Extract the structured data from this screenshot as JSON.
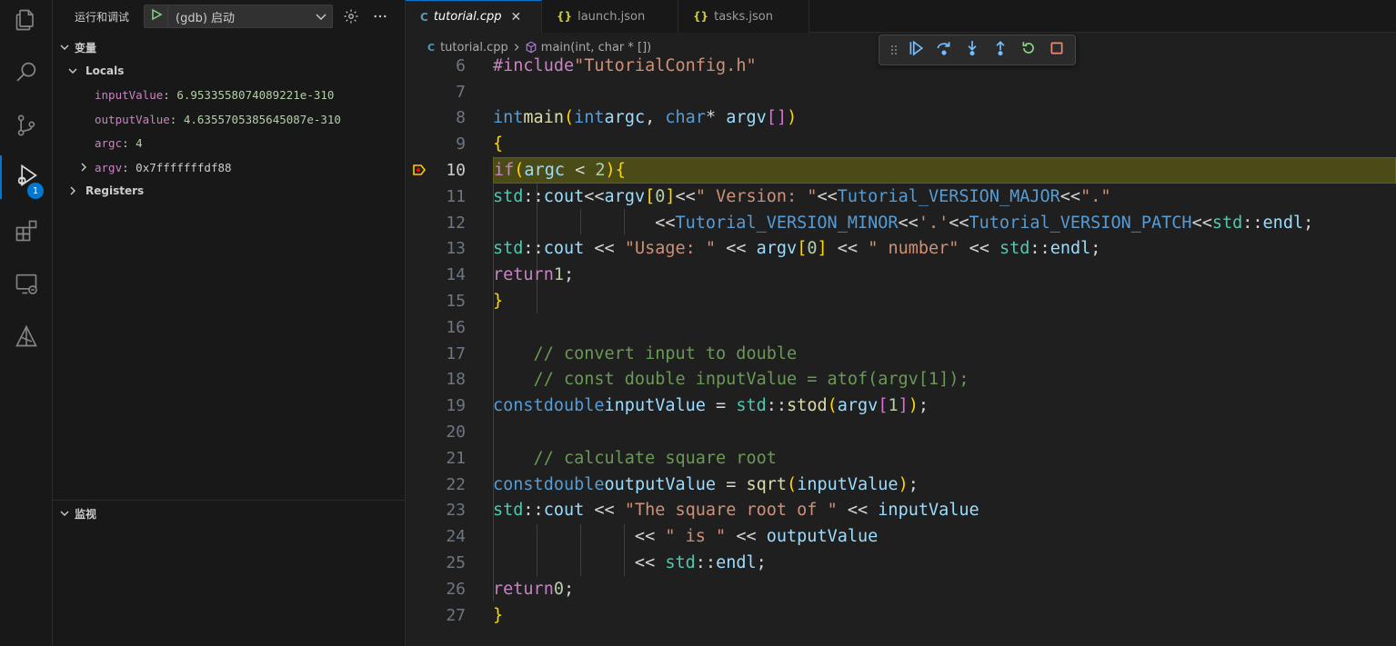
{
  "sidebar": {
    "title": "运行和调试",
    "config_label": "(gdb) 启动",
    "variables_label": "变量",
    "locals_label": "Locals",
    "variables": [
      {
        "name": "inputValue",
        "value": "6.9533558074089221e-310"
      },
      {
        "name": "outputValue",
        "value": "4.6355705385645087e-310"
      },
      {
        "name": "argc",
        "value": "4"
      },
      {
        "name": "argv",
        "value": "0x7fffffffdf88"
      }
    ],
    "registers_label": "Registers",
    "watch_label": "监视"
  },
  "activity": {
    "badge": "1",
    "icons": [
      "explorer-icon",
      "search-icon",
      "source-control-icon",
      "run-debug-icon",
      "extensions-icon",
      "remote-explorer-icon",
      "cmake-icon"
    ]
  },
  "tabs": [
    {
      "label": "tutorial.cpp",
      "icon": "C",
      "active": true
    },
    {
      "label": "launch.json",
      "icon": "{}",
      "active": false
    },
    {
      "label": "tasks.json",
      "icon": "{}",
      "active": false
    }
  ],
  "breadcrumb": {
    "file": "tutorial.cpp",
    "symbol": "main(int, char * [])"
  },
  "code": {
    "current_line": 10,
    "lines": [
      {
        "n": "6",
        "text": "#include \"TutorialConfig.h\""
      },
      {
        "n": "7",
        "text": ""
      },
      {
        "n": "8",
        "text": "int main(int argc, char* argv[])"
      },
      {
        "n": "9",
        "text": "{"
      },
      {
        "n": "10",
        "text": "    if (argc < 2) {"
      },
      {
        "n": "11",
        "text": "        std::cout<<argv[0]<<\" Version: \"<<Tutorial_VERSION_MAJOR<<\".\""
      },
      {
        "n": "12",
        "text": "                <<Tutorial_VERSION_MINOR<<'.'<<Tutorial_VERSION_PATCH<<std::endl;"
      },
      {
        "n": "13",
        "text": "        std::cout << \"Usage: \" << argv[0] << \" number\" << std::endl;"
      },
      {
        "n": "14",
        "text": "        return 1;"
      },
      {
        "n": "15",
        "text": "    }"
      },
      {
        "n": "16",
        "text": ""
      },
      {
        "n": "17",
        "text": "    // convert input to double"
      },
      {
        "n": "18",
        "text": "    // const double inputValue = atof(argv[1]);"
      },
      {
        "n": "19",
        "text": "    const double inputValue = std::stod(argv[1]);"
      },
      {
        "n": "20",
        "text": ""
      },
      {
        "n": "21",
        "text": "    // calculate square root"
      },
      {
        "n": "22",
        "text": "    const double outputValue = sqrt(inputValue);"
      },
      {
        "n": "23",
        "text": "    std::cout << \"The square root of \" << inputValue"
      },
      {
        "n": "24",
        "text": "              << \" is \" << outputValue"
      },
      {
        "n": "25",
        "text": "              << std::endl;"
      },
      {
        "n": "26",
        "text": "    return 0;"
      },
      {
        "n": "27",
        "text": "}"
      }
    ]
  },
  "colors": {
    "accent": "#0078d4",
    "current_line_bg": "#4b4b18",
    "breakpoint_arrow": "#ffcc00"
  }
}
